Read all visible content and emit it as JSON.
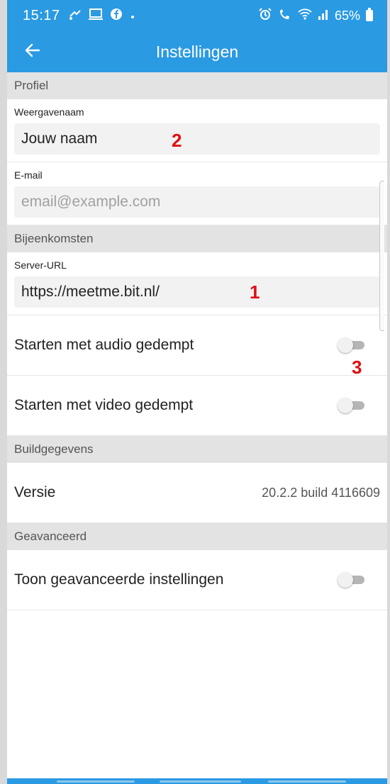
{
  "status_bar": {
    "time": "15:17",
    "left_icons": [
      "missed-call-icon",
      "cast-icon",
      "facebook-icon",
      "dot-icon"
    ],
    "right_icons": [
      "alarm-icon",
      "wifi-calling-icon",
      "wifi-icon",
      "signal-icon"
    ],
    "battery": "65%"
  },
  "app_bar": {
    "title": "Instellingen",
    "back_icon": "arrow-back-icon",
    "color": "#2a9ae3"
  },
  "sections": {
    "profile": {
      "header": "Profiel",
      "display_name": {
        "label": "Weergavenaam",
        "value": "Jouw naam",
        "annotation": "2"
      },
      "email": {
        "label": "E-mail",
        "placeholder": "email@example.com"
      }
    },
    "meetings": {
      "header": "Bijeenkomsten",
      "server_url": {
        "label": "Server-URL",
        "value": "https://meetme.bit.nl/",
        "annotation": "1"
      },
      "audio_muted": {
        "label": "Starten met audio gedempt",
        "on": false,
        "annotation": "3"
      },
      "video_muted": {
        "label": "Starten met video gedempt",
        "on": false
      }
    },
    "build": {
      "header": "Buildgegevens",
      "version_label": "Versie",
      "version_value": "20.2.2 build 4116609"
    },
    "advanced": {
      "header": "Geavanceerd",
      "show_advanced": {
        "label": "Toon geavanceerde instellingen",
        "on": false
      }
    }
  }
}
